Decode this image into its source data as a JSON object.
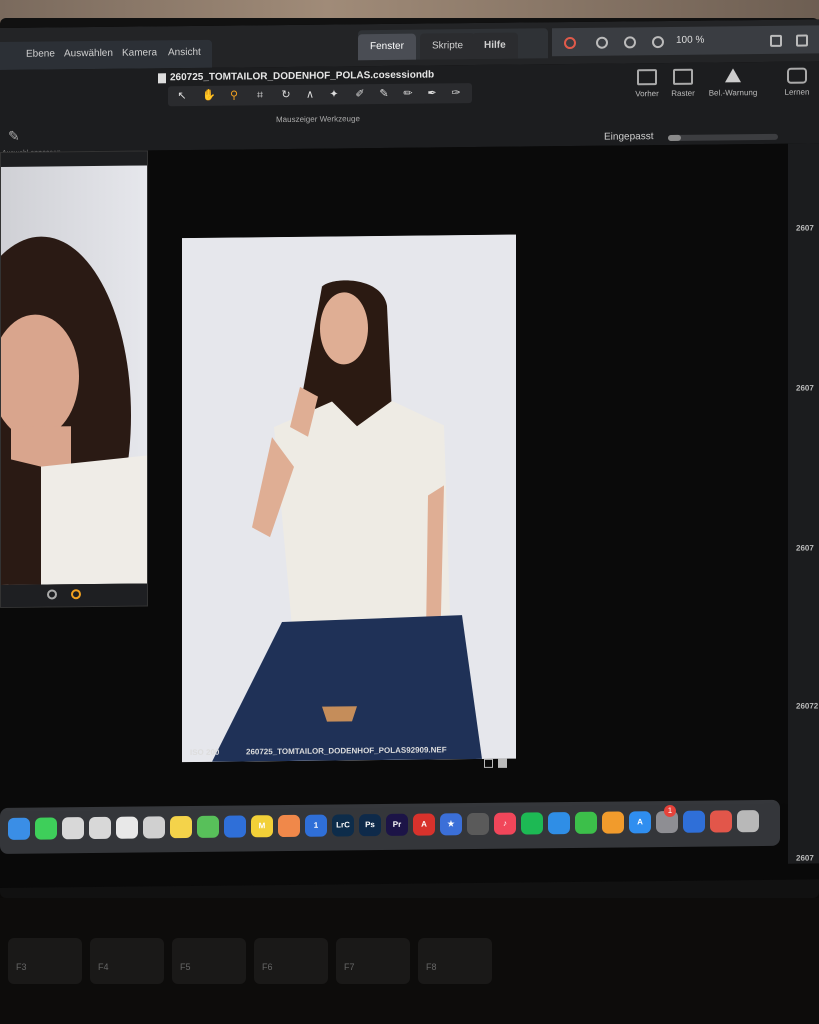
{
  "menu": {
    "left_items": [
      "Ebene",
      "Auswählen",
      "Kamera",
      "Ansicht"
    ],
    "right_items": [
      "Fenster",
      "Skripte",
      "Hilfe"
    ],
    "active_item": "Fenster",
    "zoom": "100 %"
  },
  "toolbar": {
    "document_title": "260725_TOMTAILOR_DODENHOF_POLAS.cosessiondb",
    "tools_caption": "Mauszeiger Werkzeuge",
    "left_tool_caption": "Auswahl anpassen",
    "buttons": [
      {
        "label": "Vorher",
        "icon": "before-after-icon"
      },
      {
        "label": "Raster",
        "icon": "grid-icon"
      },
      {
        "label": "Bel.-Warnung",
        "icon": "exposure-warning-icon"
      },
      {
        "label": "Lernen",
        "icon": "camera-icon"
      }
    ],
    "fit_label": "Eingepasst",
    "zoom_fraction": 0.12
  },
  "viewer": {
    "iso": "ISO 200",
    "filename": "260725_TOMTAILOR_DODENHOF_POLAS92909.NEF"
  },
  "right_panel": {
    "labels": [
      "2607",
      "2607",
      "2607",
      "26072",
      "2607"
    ]
  },
  "dock": {
    "apps": [
      {
        "name": "finder",
        "glyph": "",
        "color": "#3a8ee6"
      },
      {
        "name": "messages",
        "glyph": "",
        "color": "#3ecf5a"
      },
      {
        "name": "app",
        "glyph": "",
        "color": "#d8d8d8"
      },
      {
        "name": "app",
        "glyph": "",
        "color": "#d8d8d8"
      },
      {
        "name": "app",
        "glyph": "",
        "color": "#e8e8e8"
      },
      {
        "name": "app",
        "glyph": "",
        "color": "#d0d0d0"
      },
      {
        "name": "notes",
        "glyph": "",
        "color": "#f4d34a"
      },
      {
        "name": "app",
        "glyph": "",
        "color": "#58c05a"
      },
      {
        "name": "app",
        "glyph": "",
        "color": "#2f6fd8"
      },
      {
        "name": "miro",
        "glyph": "M",
        "color": "#f2d038"
      },
      {
        "name": "app",
        "glyph": "",
        "color": "#f0884a"
      },
      {
        "name": "1password",
        "glyph": "1",
        "color": "#2f6fd8"
      },
      {
        "name": "lightroom-classic",
        "glyph": "LrC",
        "color": "#0d2c4a"
      },
      {
        "name": "photoshop",
        "glyph": "Ps",
        "color": "#0e2a4a"
      },
      {
        "name": "premiere",
        "glyph": "Pr",
        "color": "#1c1447"
      },
      {
        "name": "acrobat",
        "glyph": "A",
        "color": "#d8322c"
      },
      {
        "name": "app",
        "glyph": "★",
        "color": "#3b6fd8"
      },
      {
        "name": "app",
        "glyph": "",
        "color": "#5a5a5a"
      },
      {
        "name": "music",
        "glyph": "♪",
        "color": "#f1465a"
      },
      {
        "name": "spotify",
        "glyph": "",
        "color": "#1db954"
      },
      {
        "name": "keynote",
        "glyph": "",
        "color": "#2f8ee6"
      },
      {
        "name": "numbers",
        "glyph": "",
        "color": "#3cbf4a"
      },
      {
        "name": "pages",
        "glyph": "",
        "color": "#f19b2c"
      },
      {
        "name": "app-store",
        "glyph": "A",
        "color": "#2f8ef0"
      },
      {
        "name": "system-settings",
        "glyph": "",
        "color": "#8e8e93"
      },
      {
        "name": "app",
        "glyph": "",
        "color": "#2f6fd8"
      },
      {
        "name": "folder",
        "glyph": "",
        "color": "#e2564a"
      },
      {
        "name": "trash",
        "glyph": "",
        "color": "#b8b8b8"
      }
    ],
    "badge": "1"
  },
  "keyboard": {
    "keys": [
      "F3",
      "F4",
      "F5",
      "F6",
      "F7",
      "F8"
    ]
  }
}
